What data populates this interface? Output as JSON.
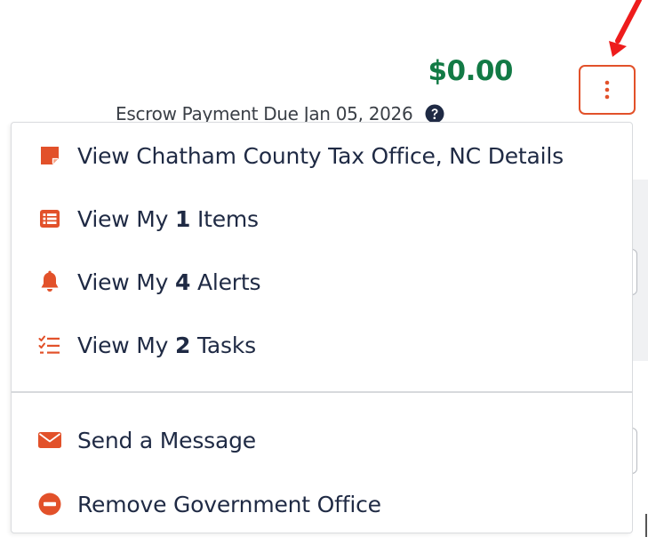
{
  "balance": {
    "amount": "$0.00",
    "escrow_text": "Escrow Payment Due Jan 05, 2026"
  },
  "colors": {
    "accent": "#e2512a",
    "amount_green": "#127a45",
    "text_dark": "#1f2a44",
    "arrow_red": "#ee1c1c"
  },
  "menu": {
    "items": [
      {
        "icon": "note-icon",
        "label": "View Chatham County Tax Office, NC Details"
      },
      {
        "icon": "list-icon",
        "prefix": "View My ",
        "count": "1",
        "suffix": " Items"
      },
      {
        "icon": "bell-icon",
        "prefix": "View My ",
        "count": "4",
        "suffix": " Alerts"
      },
      {
        "icon": "task-list-icon",
        "prefix": "View My ",
        "count": "2",
        "suffix": " Tasks"
      },
      {
        "icon": "envelope-icon",
        "label": "Send a Message"
      },
      {
        "icon": "minus-circle-icon",
        "label": "Remove Government Office"
      }
    ]
  }
}
